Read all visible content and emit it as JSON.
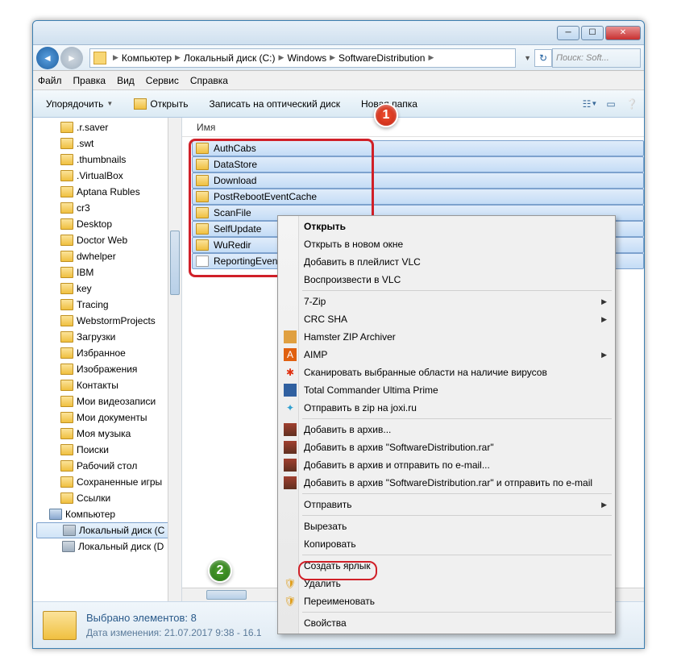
{
  "breadcrumbs": [
    "Компьютер",
    "Локальный диск (C:)",
    "Windows",
    "SoftwareDistribution"
  ],
  "search_placeholder": "Поиск: Soft...",
  "menu": {
    "file": "Файл",
    "edit": "Правка",
    "view": "Вид",
    "tools": "Сервис",
    "help": "Справка"
  },
  "toolbar": {
    "organize": "Упорядочить",
    "open": "Открыть",
    "burn": "Записать на оптический диск",
    "newfolder": "Новая папка"
  },
  "column_header": "Имя",
  "sidebar_items": [
    ".r.saver",
    ".swt",
    ".thumbnails",
    ".VirtualBox",
    "Aptana Rubles",
    "cr3",
    "Desktop",
    "Doctor Web",
    "dwhelper",
    "IBM",
    "key",
    "Tracing",
    "WebstormProjects",
    "Загрузки",
    "Избранное",
    "Изображения",
    "Контакты",
    "Мои видеозаписи",
    "Мои документы",
    "Моя музыка",
    "Поиски",
    "Рабочий стол",
    "Сохраненные игры",
    "Ссылки"
  ],
  "sidebar_computer": "Компьютер",
  "sidebar_drives": [
    "Локальный диск (C",
    "Локальный диск (D"
  ],
  "files": [
    {
      "name": "AuthCabs",
      "type": "folder"
    },
    {
      "name": "DataStore",
      "type": "folder"
    },
    {
      "name": "Download",
      "type": "folder"
    },
    {
      "name": "PostRebootEventCache",
      "type": "folder"
    },
    {
      "name": "ScanFile",
      "type": "folder"
    },
    {
      "name": "SelfUpdate",
      "type": "folder"
    },
    {
      "name": "WuRedir",
      "type": "folder"
    },
    {
      "name": "ReportingEvents.log",
      "type": "log"
    }
  ],
  "context_menu": {
    "open": "Открыть",
    "open_new": "Открыть в новом окне",
    "vlc_playlist": "Добавить в плейлист VLC",
    "vlc_play": "Воспроизвести в VLC",
    "sevenzip": "7-Zip",
    "crc": "CRC SHA",
    "hamster": "Hamster ZIP Archiver",
    "aimp": "AIMP",
    "scan": "Сканировать выбранные области на наличие вирусов",
    "tc": "Total Commander Ultima Prime",
    "joxi": "Отправить в zip на joxi.ru",
    "rar_add": "Добавить в архив...",
    "rar_add_name": "Добавить в архив \"SoftwareDistribution.rar\"",
    "rar_email": "Добавить в архив и отправить по e-mail...",
    "rar_email_name": "Добавить в архив \"SoftwareDistribution.rar\" и отправить по e-mail",
    "send": "Отправить",
    "cut": "Вырезать",
    "copy": "Копировать",
    "shortcut": "Создать ярлык",
    "delete": "Удалить",
    "rename": "Переименовать",
    "properties": "Свойства"
  },
  "details": {
    "selected": "Выбрано элементов: 8",
    "modified": "Дата изменения: 21.07.2017 9:38 - 16.1"
  },
  "badge1": "1",
  "badge2": "2"
}
